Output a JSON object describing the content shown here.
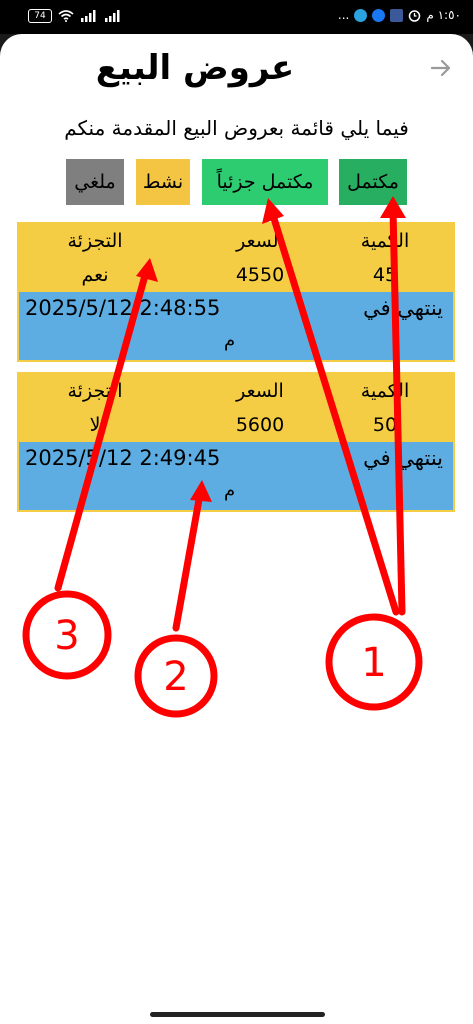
{
  "status_bar": {
    "battery": "74",
    "time": "١:٥٠ م",
    "dots": "..."
  },
  "header": {
    "title": "عروض البيع",
    "back_icon": "arrow-right-icon"
  },
  "subtitle": "فيما يلي قائمة بعروض البيع المقدمة منكم",
  "filters": [
    {
      "label": "مكتمل",
      "color": "#27ae60"
    },
    {
      "label": "مكتمل جزئياً",
      "color": "#2ecc71"
    },
    {
      "label": "نشط",
      "color": "#f4c542"
    },
    {
      "label": "ملغي",
      "color": "#7f7f7f"
    }
  ],
  "columns": {
    "quantity": "الكمية",
    "price": "السعر",
    "split": "التجزئة"
  },
  "offers": [
    {
      "quantity": "45",
      "price": "4550",
      "split": "نعم",
      "expires_label": "ينتهي في",
      "expires_date": "2025/5/12 2:48:55",
      "expires_ampm": "م"
    },
    {
      "quantity": "50",
      "price": "5600",
      "split": "لا",
      "expires_label": "ينتهي في",
      "expires_date": "2025/5/12 2:49:45",
      "expires_ampm": "م"
    }
  ],
  "annotations": [
    "1",
    "2",
    "3"
  ],
  "colors": {
    "card_bg": "#f4cd45",
    "expiry_bg": "#5dade2",
    "annotation_red": "#ff0000"
  }
}
